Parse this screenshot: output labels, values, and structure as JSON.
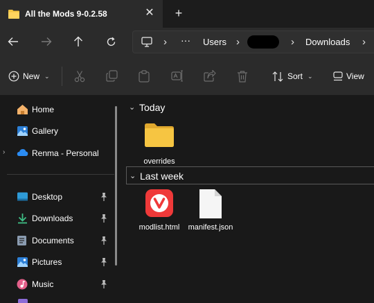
{
  "window": {
    "tab_title": "All the Mods 9-0.2.58",
    "close_glyph": "✕",
    "new_tab_glyph": "+"
  },
  "navigation": {
    "back": "arrow-left-icon",
    "forward": "arrow-right-icon",
    "up": "arrow-up-icon",
    "refresh": "refresh-icon"
  },
  "address_bar": {
    "overflow": "···",
    "crumbs": [
      "Users",
      "Downloads"
    ],
    "separator": "›"
  },
  "command_bar": {
    "new_label": "New",
    "sort_label": "Sort",
    "view_label": "View"
  },
  "sidebar": {
    "home": "Home",
    "gallery": "Gallery",
    "onedrive": "Renma - Personal",
    "desktop": "Desktop",
    "downloads": "Downloads",
    "documents": "Documents",
    "pictures": "Pictures",
    "music": "Music"
  },
  "groups": {
    "today_label": "Today",
    "last_week_label": "Last week"
  },
  "files": {
    "overrides": "overrides",
    "modlist": "modlist.html",
    "manifest": "manifest.json"
  },
  "colors": {
    "accent_folder": "#f4c542",
    "vivaldi_red": "#ef3939",
    "onedrive_blue": "#2b8cf3"
  }
}
